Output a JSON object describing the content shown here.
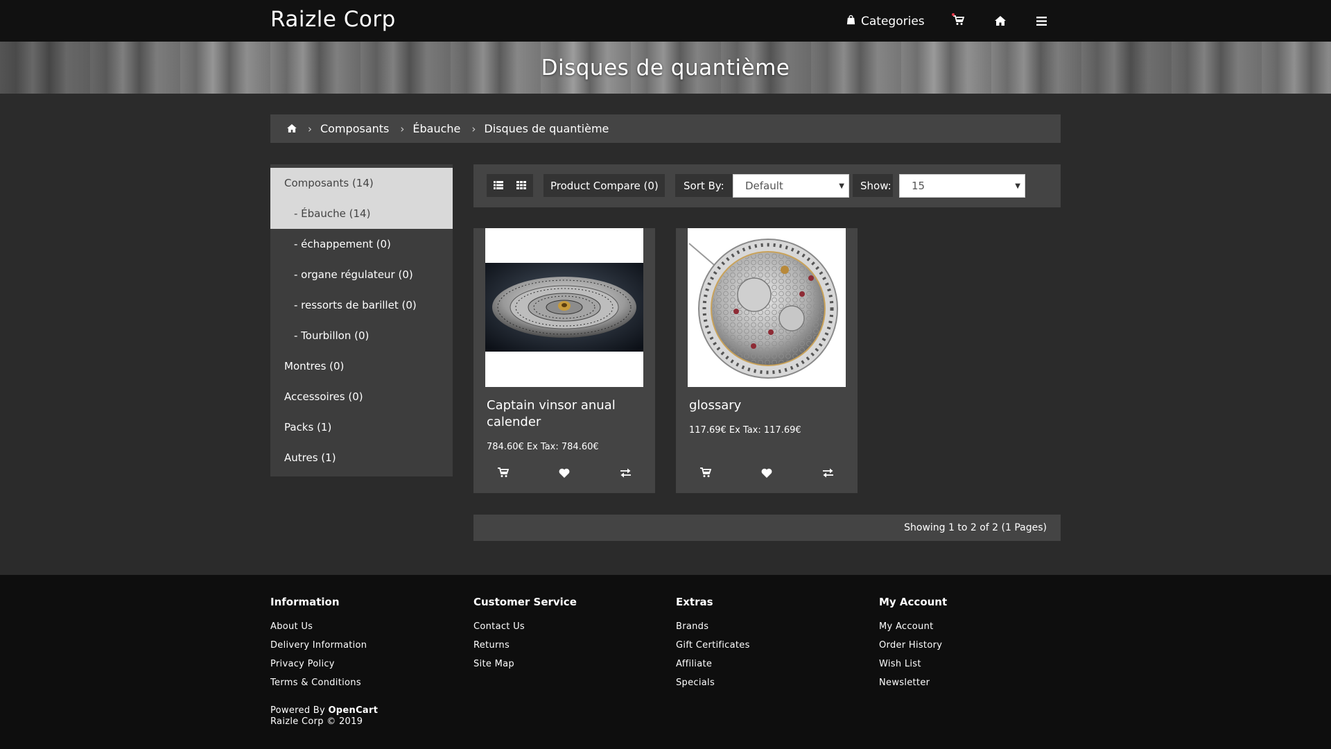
{
  "header": {
    "brand": "Raizle Corp",
    "categories_label": "Categories",
    "icons": [
      "shopping-bag-icon",
      "cart-icon",
      "home-icon",
      "menu-icon"
    ]
  },
  "banner": {
    "title": "Disques de quantième"
  },
  "breadcrumb": {
    "items": [
      "Composants",
      "Ébauche",
      "Disques de quantième"
    ],
    "separator": "›"
  },
  "sidebar": {
    "items": [
      {
        "label": "Composants (14)",
        "active": true
      },
      {
        "label": "- Ébauche (14)",
        "active": true
      },
      {
        "label": "- échappement (0)"
      },
      {
        "label": "- organe régulateur (0)"
      },
      {
        "label": "- ressorts de barillet (0)"
      },
      {
        "label": "- Tourbillon (0)"
      },
      {
        "label": "Montres (0)"
      },
      {
        "label": "Accessoires (0)"
      },
      {
        "label": "Packs (1)"
      },
      {
        "label": "Autres (1)"
      }
    ]
  },
  "toolbar": {
    "compare_label": "Product Compare (0)",
    "sort_label": "Sort By:",
    "sort_value": "Default",
    "show_label": "Show:",
    "show_value": "15"
  },
  "products": [
    {
      "name": "Captain vinsor anual calender",
      "price": "784.60€ Ex Tax: 784.60€"
    },
    {
      "name": "glossary",
      "price": "117.69€ Ex Tax: 117.69€"
    }
  ],
  "results_text": "Showing 1 to 2 of 2 (1 Pages)",
  "footer": {
    "columns": [
      {
        "title": "Information",
        "links": [
          "About Us",
          "Delivery Information",
          "Privacy Policy",
          "Terms & Conditions"
        ]
      },
      {
        "title": "Customer Service",
        "links": [
          "Contact Us",
          "Returns",
          "Site Map"
        ]
      },
      {
        "title": "Extras",
        "links": [
          "Brands",
          "Gift Certificates",
          "Affiliate",
          "Specials"
        ]
      },
      {
        "title": "My Account",
        "links": [
          "My Account",
          "Order History",
          "Wish List",
          "Newsletter"
        ]
      }
    ],
    "powered_by": "Powered By",
    "powered_link": "OpenCart",
    "copyright": "Raizle Corp © 2019"
  },
  "colors": {
    "page_bg": "#2b2b2b",
    "nav_bg": "#111111",
    "panel_bg": "#444444",
    "active_item_bg": "#d9d9d9",
    "footer_bg": "#0e0e0e",
    "cart_dot": "#e8394a"
  }
}
